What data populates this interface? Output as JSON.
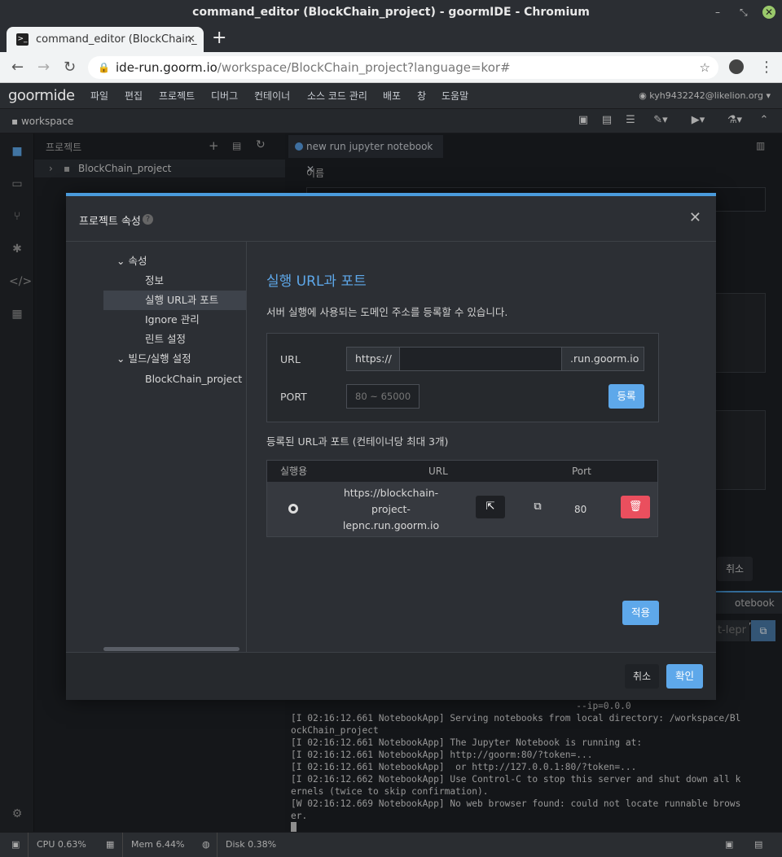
{
  "window": {
    "title": "command_editor (BlockChain_project) - goormIDE - Chromium"
  },
  "browser": {
    "tab_title": "command_editor (BlockChain_",
    "url_host": "ide-run.goorm.io",
    "url_path": "/workspace/BlockChain_project?language=kor#"
  },
  "ide": {
    "logo": "goormide",
    "menu": [
      "파일",
      "편집",
      "프로젝트",
      "디버그",
      "컨테이너",
      "소스 코드 관리",
      "배포",
      "창",
      "도움말"
    ],
    "user": "kyh9432242@likelion.org",
    "workspace": "workspace",
    "project_panel_title": "프로젝트",
    "project_name": "BlockChain_project",
    "editor_tab": "new run jupyter notebook",
    "editor_name_label": "이름",
    "cancel_behind": "취소",
    "notebook_tab": "otebook",
    "terminal_snip": "t-lepr",
    "terminal_lines": [
      "                                                    --ip=0.0.0",
      "[I 02:16:12.661 NotebookApp] Serving notebooks from local directory: /workspace/Bl",
      "ockChain_project",
      "[I 02:16:12.661 NotebookApp] The Jupyter Notebook is running at:",
      "[I 02:16:12.661 NotebookApp] http://goorm:80/?token=...",
      "[I 02:16:12.661 NotebookApp]  or http://127.0.0.1:80/?token=...",
      "[I 02:16:12.662 NotebookApp] Use Control-C to stop this server and shut down all k",
      "ernels (twice to skip confirmation).",
      "[W 02:16:12.669 NotebookApp] No web browser found: could not locate runnable brows",
      "er."
    ]
  },
  "status": {
    "cpu": "CPU 0.63%",
    "mem": "Mem 6.44%",
    "disk": "Disk 0.38%"
  },
  "modal": {
    "title": "프로젝트 속성",
    "tree": {
      "props": "속성",
      "info": "정보",
      "run_url": "실행 URL과 포트",
      "ignore": "Ignore 관리",
      "lint": "린트 설정",
      "build": "빌드/실행 설정",
      "build_project": "BlockChain_project"
    },
    "heading": "실행 URL과 포트",
    "description": "서버 실행에 사용되는 도메인 주소를 등록할 수 있습니다.",
    "url_label": "URL",
    "url_prefix": "https://",
    "url_value": "",
    "url_suffix": ".run.goorm.io",
    "port_label": "PORT",
    "port_placeholder": "80 ~ 65000",
    "register_btn": "등록",
    "registered_title": "등록된 URL과 포트 (컨테이너당 최대 3개)",
    "table_headers": {
      "run": "실행용",
      "url": "URL",
      "port": "Port"
    },
    "row": {
      "url_line1": "https://blockchain-",
      "url_line2": "project-",
      "url_line3": "lepnc.run.goorm.io",
      "port": "80"
    },
    "apply_btn": "적용",
    "cancel_btn": "취소",
    "ok_btn": "확인"
  },
  "colors": {
    "accent": "#5ea8ea",
    "danger": "#ea4f5e",
    "modal_top": "#4a9bdc"
  }
}
